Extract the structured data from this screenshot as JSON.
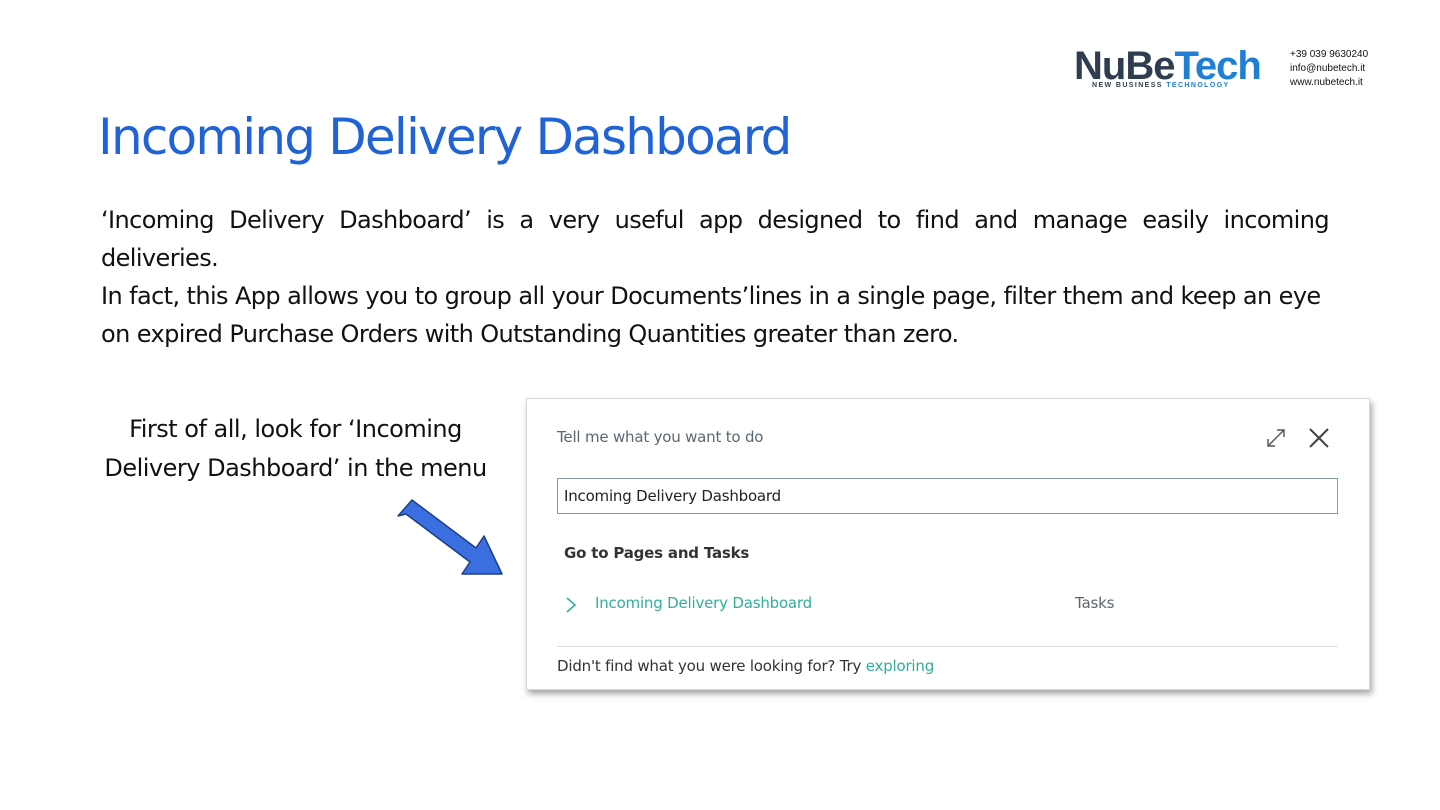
{
  "brand": {
    "logo_dark": "NuBe",
    "logo_blue": "Tech",
    "tagline_dark": "NEW BUSINESS ",
    "tagline_blue": "TECHNOLOGY",
    "phone": "+39 039 9630240",
    "email": "info@nubetech.it",
    "website": "www.nubetech.it",
    "colors": {
      "dark": "#2e3d4f",
      "blue": "#1f7fd4"
    }
  },
  "slide": {
    "title": "Incoming Delivery Dashboard",
    "paragraph1": "‘Incoming Delivery Dashboard’ is a very useful app designed to find and manage easily incoming deliveries.",
    "paragraph2": "In fact, this App allows you to group all your Documents’lines in a single page, filter them and keep an eye on expired Purchase Orders with Outstanding Quantities greater than zero.",
    "hint": "First of all, look for ‘Incoming Delivery Dashboard’ in the menu",
    "title_color": "#1f63d6",
    "arrow_icon": "arrow-right-down-icon",
    "arrow_color": "#3b6fe0"
  },
  "dialog": {
    "prompt": "Tell me what you want to do",
    "search_value": "Incoming Delivery Dashboard",
    "section_heading": "Go to Pages and Tasks",
    "results": [
      {
        "name": "Incoming Delivery Dashboard",
        "category": "Tasks"
      }
    ],
    "footer_text": "Didn't find what you were looking for? Try ",
    "footer_link": "exploring",
    "icons": {
      "expand": "expand-icon",
      "close": "close-icon",
      "chevron": "chevron-right-icon"
    },
    "accent_color": "#2fae9a"
  }
}
